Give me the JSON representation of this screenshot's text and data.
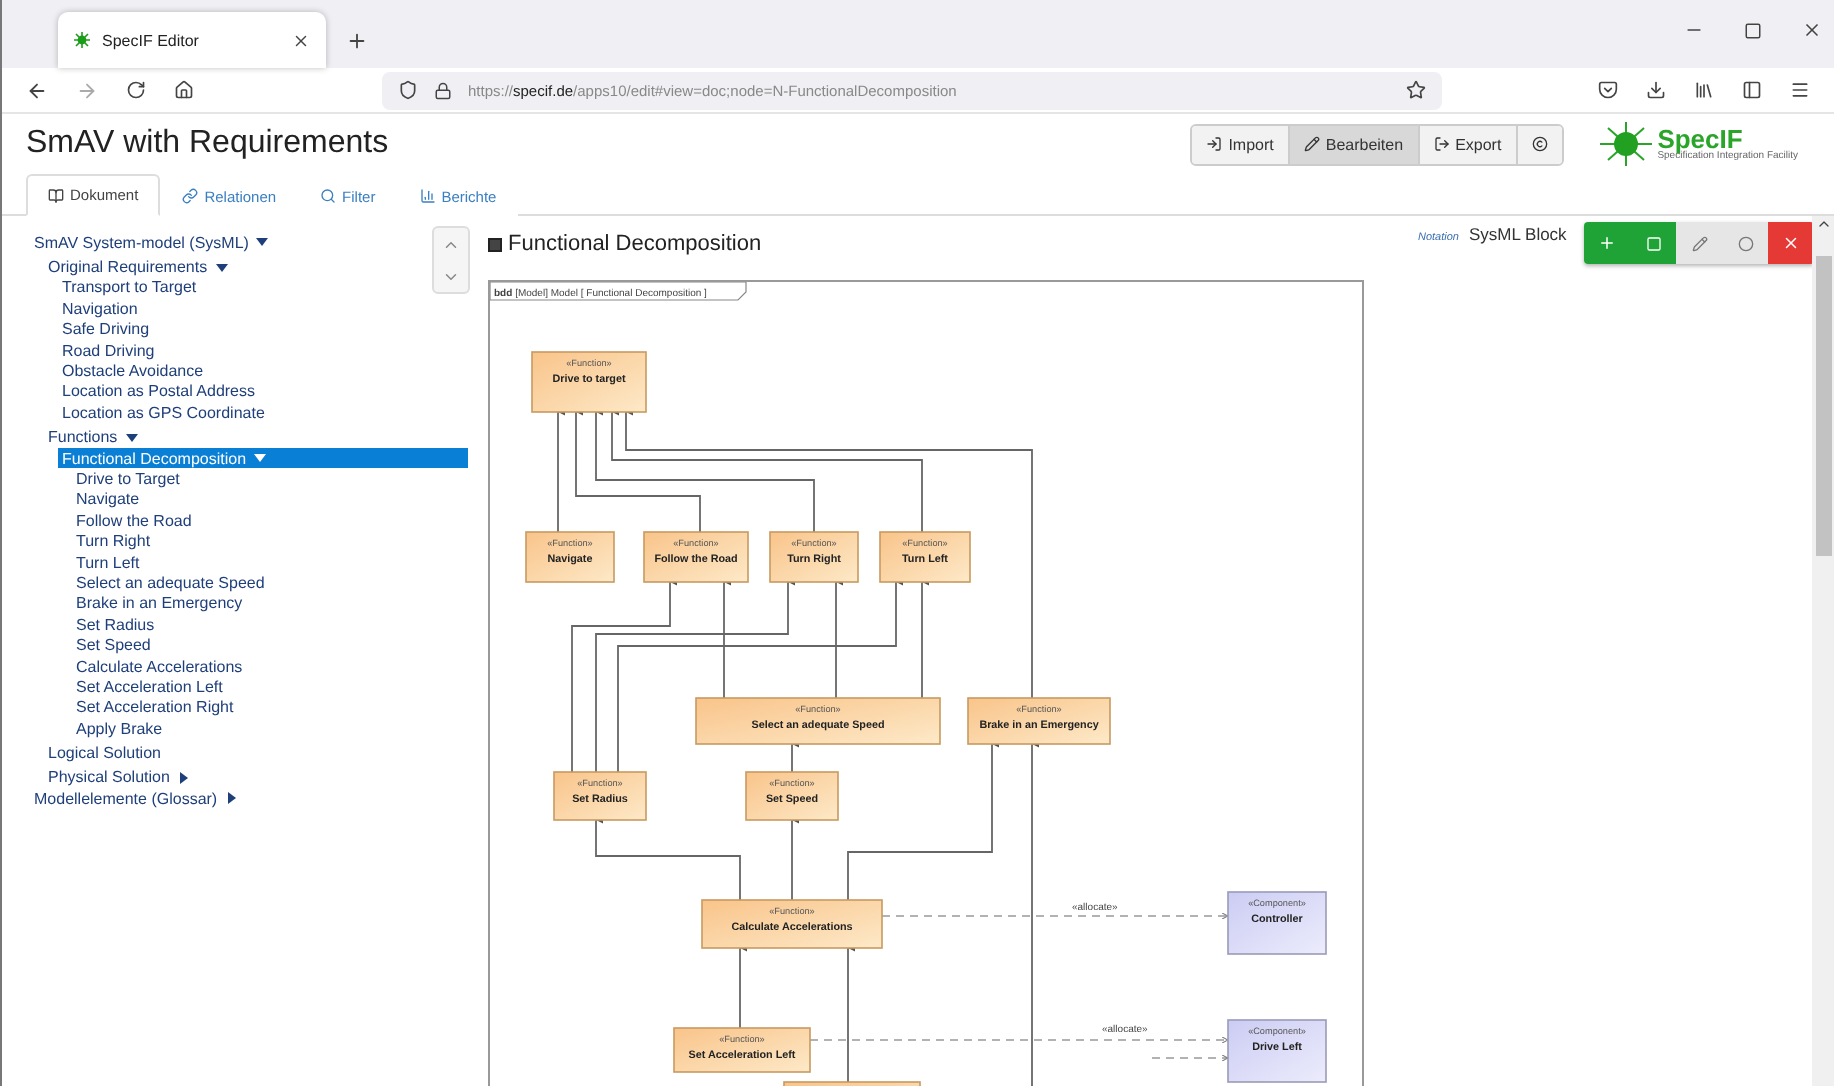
{
  "browser": {
    "tab_title": "SpecIF Editor",
    "url_prefix": "https://",
    "url_host": "specif.de",
    "url_path": "/apps10/edit#view=doc;node=N-FunctionalDecomposition"
  },
  "app": {
    "title": "SmAV with Requirements",
    "actions": [
      {
        "label": "Import",
        "selected": false
      },
      {
        "label": "Bearbeiten",
        "selected": true
      },
      {
        "label": "Export",
        "selected": false
      }
    ],
    "logo": {
      "name": "SpecIF",
      "tagline": "Specification Integration Facility"
    }
  },
  "tabs": [
    {
      "label": "Dokument",
      "selected": true
    },
    {
      "label": "Relationen",
      "selected": false
    },
    {
      "label": "Filter",
      "selected": false
    },
    {
      "label": "Berichte",
      "selected": false
    }
  ],
  "tree": [
    {
      "label": "SmAV System-model (SysML)",
      "selected": false,
      "expanded": true,
      "children": [
        {
          "label": "Original Requirements",
          "selected": false,
          "expanded": true,
          "children": [
            {
              "label": "Transport to Target",
              "selected": false
            },
            {
              "label": "Navigation",
              "selected": false
            },
            {
              "label": "Safe Driving",
              "selected": false
            },
            {
              "label": "Road Driving",
              "selected": false
            },
            {
              "label": "Obstacle Avoidance",
              "selected": false
            },
            {
              "label": "Location as Postal Address",
              "selected": false
            },
            {
              "label": "Location as GPS Coordinate",
              "selected": false
            }
          ]
        },
        {
          "label": "Functions",
          "selected": false,
          "expanded": true,
          "children": [
            {
              "label": "Functional Decomposition",
              "selected": true,
              "expanded": true,
              "children": [
                {
                  "label": "Drive to Target",
                  "selected": false
                },
                {
                  "label": "Navigate",
                  "selected": false
                },
                {
                  "label": "Follow the Road",
                  "selected": false
                },
                {
                  "label": "Turn Right",
                  "selected": false
                },
                {
                  "label": "Turn Left",
                  "selected": false
                },
                {
                  "label": "Select an adequate Speed",
                  "selected": false
                },
                {
                  "label": "Brake in an Emergency",
                  "selected": false
                },
                {
                  "label": "Set Radius",
                  "selected": false
                },
                {
                  "label": "Set Speed",
                  "selected": false
                },
                {
                  "label": "Calculate Accelerations",
                  "selected": false
                },
                {
                  "label": "Set Acceleration Left",
                  "selected": false
                },
                {
                  "label": "Set Acceleration Right",
                  "selected": false
                },
                {
                  "label": "Apply Brake",
                  "selected": false
                }
              ]
            }
          ]
        },
        {
          "label": "Logical Solution",
          "selected": false
        },
        {
          "label": "Physical Solution",
          "selected": false,
          "expanded": false
        }
      ]
    },
    {
      "label": "Modellelemente (Glossar)",
      "selected": false,
      "expanded": false
    }
  ],
  "document": {
    "heading": "Functional Decomposition",
    "notation_label": "Notation",
    "notation_value": "SysML Block",
    "diagram": {
      "frame_kind": "bdd",
      "frame_label": "[Model] Model [ Functional Decomposition ]",
      "nodes": [
        {
          "kind": "function",
          "stereotype": "«Function»",
          "name": "Drive to target"
        },
        {
          "kind": "function",
          "stereotype": "«Function»",
          "name": "Navigate"
        },
        {
          "kind": "function",
          "stereotype": "«Function»",
          "name": "Follow the Road"
        },
        {
          "kind": "function",
          "stereotype": "«Function»",
          "name": "Turn Right"
        },
        {
          "kind": "function",
          "stereotype": "«Function»",
          "name": "Turn Left"
        },
        {
          "kind": "function",
          "stereotype": "«Function»",
          "name": "Select an adequate Speed"
        },
        {
          "kind": "function",
          "stereotype": "«Function»",
          "name": "Brake in an Emergency"
        },
        {
          "kind": "function",
          "stereotype": "«Function»",
          "name": "Set Radius"
        },
        {
          "kind": "function",
          "stereotype": "«Function»",
          "name": "Set Speed"
        },
        {
          "kind": "function",
          "stereotype": "«Function»",
          "name": "Calculate Accelerations"
        },
        {
          "kind": "component",
          "stereotype": "«Component»",
          "name": "Controller"
        },
        {
          "kind": "function",
          "stereotype": "«Function»",
          "name": "Set Acceleration Left"
        },
        {
          "kind": "component",
          "stereotype": "«Component»",
          "name": "Drive Left"
        }
      ],
      "allocations": [
        "«allocate»",
        "«allocate»"
      ]
    }
  }
}
